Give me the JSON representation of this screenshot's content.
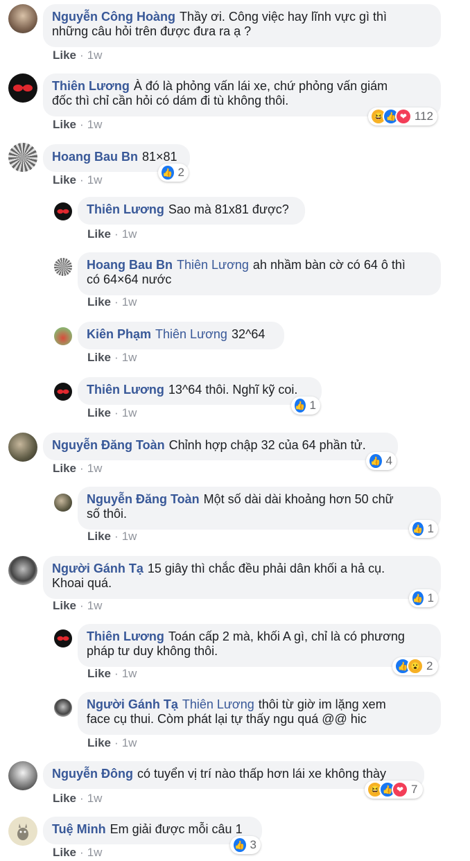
{
  "comments": [
    {
      "name": "Nguyễn Công Hoàng",
      "mention": "",
      "text": "Thầy ơi. Công việc hay lĩnh vực gì thì",
      "text2": "những câu hỏi trên được đưa ra ạ ?",
      "like": "Like",
      "time": "1w",
      "reactions": "",
      "reaction_icons": []
    },
    {
      "name": "Thiên Lương",
      "mention": "",
      "text": "À đó là phỏng vấn lái xe, chứ phỏng vấn giám",
      "text2": "đốc thì chỉ cần hỏi có dám đi tù không thôi.",
      "like": "Like",
      "time": "1w",
      "reactions": "112",
      "reaction_icons": [
        "haha",
        "like",
        "love"
      ]
    },
    {
      "name": "Hoang Bau Bn",
      "mention": "",
      "text": "81×81",
      "text2": "",
      "like": "Like",
      "time": "1w",
      "reactions": "2",
      "reaction_icons": [
        "like"
      ]
    },
    {
      "name": "Thiên Lương",
      "mention": "",
      "text": "Sao mà 81x81 được?",
      "text2": "",
      "like": "Like",
      "time": "1w",
      "reactions": "",
      "reaction_icons": []
    },
    {
      "name": "Hoang Bau Bn",
      "mention": "Thiên Lương",
      "text": "ah nhầm bàn cờ có 64 ô thì",
      "text2": "có 64×64 nước",
      "like": "Like",
      "time": "1w",
      "reactions": "",
      "reaction_icons": []
    },
    {
      "name": "Kiên Phạm",
      "mention": "Thiên Lương",
      "text": "32^64",
      "text2": "",
      "like": "Like",
      "time": "1w",
      "reactions": "",
      "reaction_icons": []
    },
    {
      "name": "Thiên Lương",
      "mention": "",
      "text": "13^64 thôi. Nghĩ kỹ coi.",
      "text2": "",
      "like": "Like",
      "time": "1w",
      "reactions": "1",
      "reaction_icons": [
        "like"
      ]
    },
    {
      "name": "Nguyễn Đăng Toàn",
      "mention": "",
      "text": "Chỉnh hợp chập 32 của 64 phần tử.",
      "text2": "",
      "like": "Like",
      "time": "1w",
      "reactions": "4",
      "reaction_icons": [
        "like"
      ]
    },
    {
      "name": "Nguyễn Đăng Toàn",
      "mention": "",
      "text": "Một số dài dài khoảng hơn 50 chữ",
      "text2": "số thôi.",
      "like": "Like",
      "time": "1w",
      "reactions": "1",
      "reaction_icons": [
        "like"
      ]
    },
    {
      "name": "Người Gánh Tạ",
      "mention": "",
      "text": "15 giây thì chắc đều phải dân khối a hả cụ.",
      "text2": "Khoai quá.",
      "like": "Like",
      "time": "1w",
      "reactions": "1",
      "reaction_icons": [
        "like"
      ]
    },
    {
      "name": "Thiên Lương",
      "mention": "",
      "text": "Toán cấp 2 mà, khối A gì, chỉ là có phương",
      "text2": "pháp tư duy không thôi.",
      "like": "Like",
      "time": "1w",
      "reactions": "2",
      "reaction_icons": [
        "like",
        "wow"
      ]
    },
    {
      "name": "Người Gánh Tạ",
      "mention": "Thiên Lương",
      "text": "thôi từ giờ im lặng xem",
      "text2": "face cụ thui. Còm phát lại tự thấy ngu quá @@ hic",
      "like": "Like",
      "time": "1w",
      "reactions": "",
      "reaction_icons": []
    },
    {
      "name": "Nguyễn Đông",
      "mention": "",
      "text": "có tuyển vị trí nào thấp hơn lái xe không thày",
      "text2": "",
      "like": "Like",
      "time": "1w",
      "reactions": "7",
      "reaction_icons": [
        "haha",
        "like",
        "love"
      ]
    },
    {
      "name": "Tuệ Minh",
      "mention": "",
      "text": "Em giải được mỗi câu 1",
      "text2": "",
      "like": "Like",
      "time": "1w",
      "reactions": "3",
      "reaction_icons": [
        "like"
      ]
    }
  ]
}
